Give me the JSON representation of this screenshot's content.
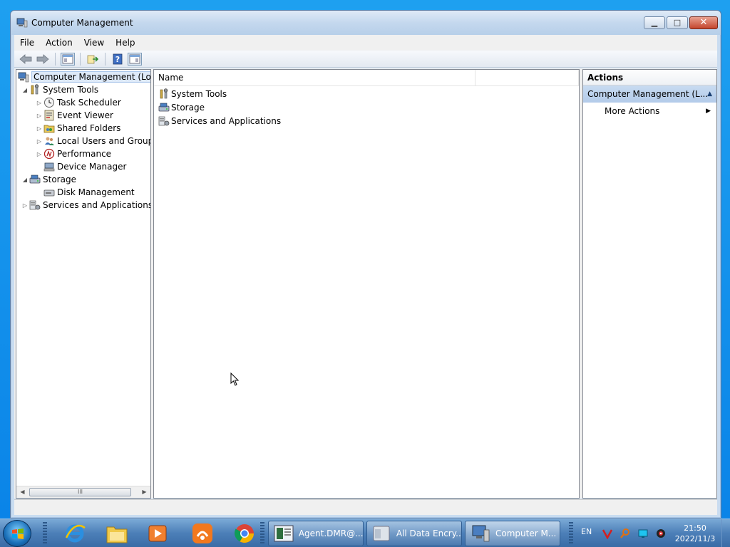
{
  "window": {
    "title": "Computer Management",
    "minimize_glyph": "▁",
    "maximize_glyph": "□",
    "close_glyph": "✕"
  },
  "menu": [
    "File",
    "Action",
    "View",
    "Help"
  ],
  "tree": {
    "root": "Computer Management (Local",
    "system_tools": "System Tools",
    "task_scheduler": "Task Scheduler",
    "event_viewer": "Event Viewer",
    "shared_folders": "Shared Folders",
    "local_users": "Local Users and Groups",
    "performance": "Performance",
    "device_manager": "Device Manager",
    "storage": "Storage",
    "disk_management": "Disk Management",
    "services_apps": "Services and Applications",
    "scroll_thumb_grip": "III"
  },
  "list": {
    "column_name": "Name",
    "items": [
      "System Tools",
      "Storage",
      "Services and Applications"
    ]
  },
  "actions": {
    "header": "Actions",
    "section": "Computer Management (L...",
    "more_actions": "More Actions"
  },
  "taskbar": {
    "tasks": [
      "Agent.DMR@...",
      "All Data Encry...",
      "Computer M..."
    ],
    "language": "EN",
    "time": "21:50",
    "date": "2022/11/3"
  },
  "colors": {
    "selection": "#dde9f8",
    "actions_section": "#b3cbe9"
  }
}
